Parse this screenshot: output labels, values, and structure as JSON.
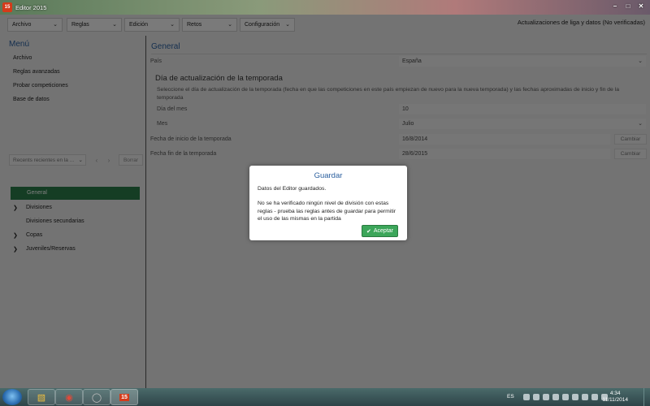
{
  "window": {
    "title": "Editor 2015",
    "app_icon": "15"
  },
  "topbar": {
    "menus": [
      "Archivo",
      "Reglas",
      "Edición",
      "Retos",
      "Configuración"
    ],
    "status": "Actualizaciones de liga y datos (No verificadas)"
  },
  "sidebar": {
    "title": "Menú",
    "items": [
      "Archivo",
      "Reglas avanzadas",
      "Probar competiciones",
      "Base de datos"
    ],
    "recent_placeholder": "Recents recientes en la ...",
    "clear_label": "Borrar",
    "tree": [
      {
        "label": "General",
        "expandable": false,
        "selected": true
      },
      {
        "label": "Divisiones",
        "expandable": true
      },
      {
        "label": "Divisiones secundarias",
        "expandable": false
      },
      {
        "label": "Copas",
        "expandable": true
      },
      {
        "label": "Juveniles/Reservas",
        "expandable": true
      }
    ]
  },
  "content": {
    "section_title": "General",
    "country_label": "País",
    "country_value": "España",
    "update_title": "Día de actualización de la temporada",
    "update_desc": "Seleccione el día de actualización de la temporada (fecha en que las competiciones en este país empiezan de nuevo para la nueva temporada) y las fechas aproximadas de inicio y fin de la temporada",
    "day_label": "Día del mes",
    "day_value": "10",
    "month_label": "Mes",
    "month_value": "Julio",
    "start_label": "Fecha de inicio de la temporada",
    "start_value": "16/8/2014",
    "end_label": "Fecha fin de la temporada",
    "end_value": "28/6/2015",
    "change_label": "Cambiar"
  },
  "dialog": {
    "title": "Guardar",
    "line1": "Datos del Editor guardados.",
    "message": "No se ha verificado ningún nivel de división con estas reglas - prueba las reglas antes de guardar para permitir el uso de las mismas en la partida",
    "ok_label": "Aceptar"
  },
  "taskbar": {
    "lang": "ES",
    "time": "4:34",
    "date": "11/11/2014"
  }
}
